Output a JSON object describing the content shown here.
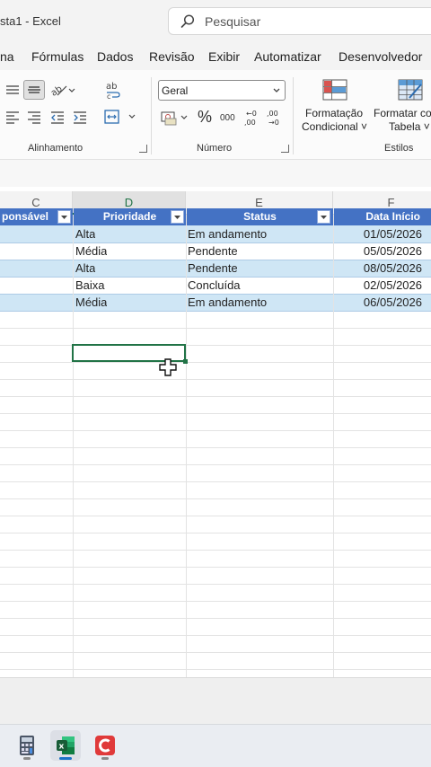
{
  "window": {
    "title": "sta1  -  Excel"
  },
  "search": {
    "placeholder": "Pesquisar"
  },
  "menu": [
    "na",
    "Fórmulas",
    "Dados",
    "Revisão",
    "Exibir",
    "Automatizar",
    "Desenvolvedor"
  ],
  "ribbon": {
    "alignment_label": "Alinhamento",
    "number_label": "Número",
    "styles_label": "Estilos",
    "number_format": "Geral",
    "percent": "%",
    "thousands": "000",
    "conditional_format_line1": "Formatação",
    "conditional_format_line2": "Condicional ˅",
    "format_table_line1": "Formatar co",
    "format_table_line2": "Tabela ˅"
  },
  "columns": [
    {
      "letter": "C",
      "active": false
    },
    {
      "letter": "D",
      "active": true
    },
    {
      "letter": "E",
      "active": false
    },
    {
      "letter": "F",
      "active": false
    }
  ],
  "table": {
    "headers": [
      "ponsável",
      "Prioridade",
      "Status",
      "Data Início"
    ],
    "rows": [
      {
        "priority": "Alta",
        "status": "Em andamento",
        "start": "01/05/2026"
      },
      {
        "priority": "Média",
        "status": "Pendente",
        "start": "05/05/2026"
      },
      {
        "priority": "Alta",
        "status": "Pendente",
        "start": "08/05/2026"
      },
      {
        "priority": "Baixa",
        "status": "Concluída",
        "start": "02/05/2026"
      },
      {
        "priority": "Média",
        "status": "Em andamento",
        "start": "06/05/2026"
      }
    ]
  },
  "colors": {
    "excel_green": "#217346",
    "table_header": "#4472c4",
    "band_light": "#cfe6f5",
    "band_white": "#ffffff"
  },
  "taskbar": {
    "apps": [
      {
        "name": "calculator-icon",
        "active": false
      },
      {
        "name": "excel-icon",
        "active": true
      },
      {
        "name": "screen-recorder-icon",
        "active": false
      }
    ]
  }
}
